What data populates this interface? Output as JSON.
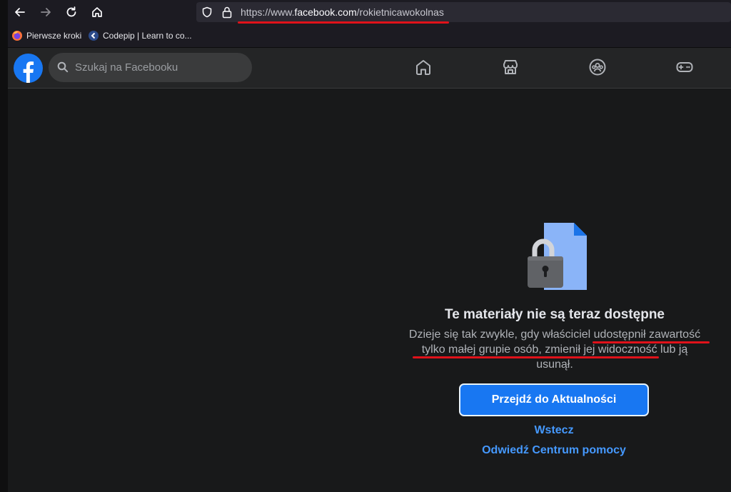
{
  "browser": {
    "url_scheme": "https://www.",
    "url_host": "facebook.com",
    "url_path": "/rokietnicawokolnas",
    "bookmarks": [
      {
        "label": "Pierwsze kroki",
        "icon": "firefox-icon"
      },
      {
        "label": "Codepip | Learn to co...",
        "icon": "codepip-icon"
      }
    ]
  },
  "header": {
    "search_placeholder": "Szukaj na Facebooku",
    "nav": [
      "home-icon",
      "marketplace-icon",
      "groups-icon",
      "gaming-icon"
    ]
  },
  "content": {
    "title": "Te materiały nie są teraz dostępne",
    "description_lines": [
      "Dzieje się tak zwykle, gdy właściciel udostępnił zawartość",
      "tylko małej grupie osób, zmienił jej widoczność lub ją",
      "usunął."
    ],
    "primary_button": "Przejdź do Aktualności",
    "back_link": "Wstecz",
    "help_link": "Odwiedź Centrum pomocy"
  },
  "colors": {
    "accent": "#1877f2",
    "link": "#4599ff",
    "annotation": "#e0121a",
    "background": "#18191a"
  }
}
